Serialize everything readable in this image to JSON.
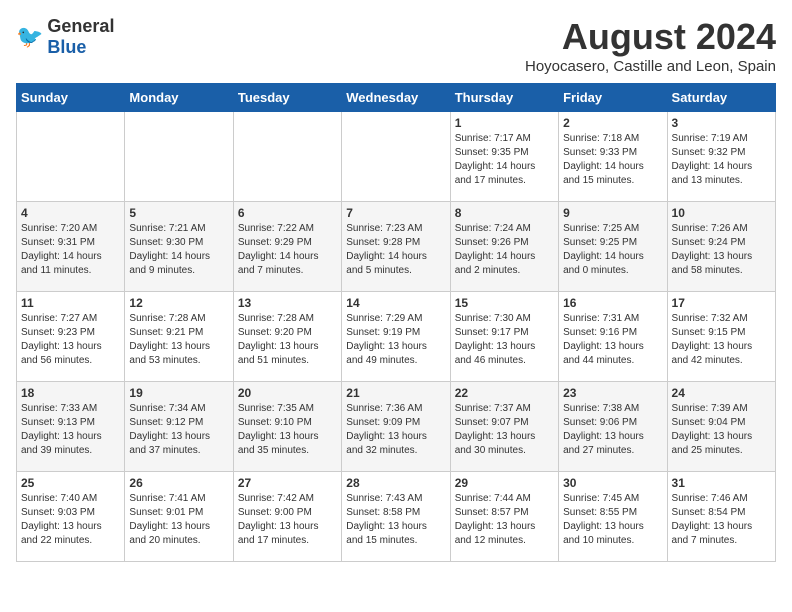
{
  "header": {
    "logo_general": "General",
    "logo_blue": "Blue",
    "title": "August 2024",
    "subtitle": "Hoyocasero, Castille and Leon, Spain"
  },
  "weekdays": [
    "Sunday",
    "Monday",
    "Tuesday",
    "Wednesday",
    "Thursday",
    "Friday",
    "Saturday"
  ],
  "weeks": [
    [
      {
        "day": "",
        "info": ""
      },
      {
        "day": "",
        "info": ""
      },
      {
        "day": "",
        "info": ""
      },
      {
        "day": "",
        "info": ""
      },
      {
        "day": "1",
        "info": "Sunrise: 7:17 AM\nSunset: 9:35 PM\nDaylight: 14 hours and 17 minutes."
      },
      {
        "day": "2",
        "info": "Sunrise: 7:18 AM\nSunset: 9:33 PM\nDaylight: 14 hours and 15 minutes."
      },
      {
        "day": "3",
        "info": "Sunrise: 7:19 AM\nSunset: 9:32 PM\nDaylight: 14 hours and 13 minutes."
      }
    ],
    [
      {
        "day": "4",
        "info": "Sunrise: 7:20 AM\nSunset: 9:31 PM\nDaylight: 14 hours and 11 minutes."
      },
      {
        "day": "5",
        "info": "Sunrise: 7:21 AM\nSunset: 9:30 PM\nDaylight: 14 hours and 9 minutes."
      },
      {
        "day": "6",
        "info": "Sunrise: 7:22 AM\nSunset: 9:29 PM\nDaylight: 14 hours and 7 minutes."
      },
      {
        "day": "7",
        "info": "Sunrise: 7:23 AM\nSunset: 9:28 PM\nDaylight: 14 hours and 5 minutes."
      },
      {
        "day": "8",
        "info": "Sunrise: 7:24 AM\nSunset: 9:26 PM\nDaylight: 14 hours and 2 minutes."
      },
      {
        "day": "9",
        "info": "Sunrise: 7:25 AM\nSunset: 9:25 PM\nDaylight: 14 hours and 0 minutes."
      },
      {
        "day": "10",
        "info": "Sunrise: 7:26 AM\nSunset: 9:24 PM\nDaylight: 13 hours and 58 minutes."
      }
    ],
    [
      {
        "day": "11",
        "info": "Sunrise: 7:27 AM\nSunset: 9:23 PM\nDaylight: 13 hours and 56 minutes."
      },
      {
        "day": "12",
        "info": "Sunrise: 7:28 AM\nSunset: 9:21 PM\nDaylight: 13 hours and 53 minutes."
      },
      {
        "day": "13",
        "info": "Sunrise: 7:28 AM\nSunset: 9:20 PM\nDaylight: 13 hours and 51 minutes."
      },
      {
        "day": "14",
        "info": "Sunrise: 7:29 AM\nSunset: 9:19 PM\nDaylight: 13 hours and 49 minutes."
      },
      {
        "day": "15",
        "info": "Sunrise: 7:30 AM\nSunset: 9:17 PM\nDaylight: 13 hours and 46 minutes."
      },
      {
        "day": "16",
        "info": "Sunrise: 7:31 AM\nSunset: 9:16 PM\nDaylight: 13 hours and 44 minutes."
      },
      {
        "day": "17",
        "info": "Sunrise: 7:32 AM\nSunset: 9:15 PM\nDaylight: 13 hours and 42 minutes."
      }
    ],
    [
      {
        "day": "18",
        "info": "Sunrise: 7:33 AM\nSunset: 9:13 PM\nDaylight: 13 hours and 39 minutes."
      },
      {
        "day": "19",
        "info": "Sunrise: 7:34 AM\nSunset: 9:12 PM\nDaylight: 13 hours and 37 minutes."
      },
      {
        "day": "20",
        "info": "Sunrise: 7:35 AM\nSunset: 9:10 PM\nDaylight: 13 hours and 35 minutes."
      },
      {
        "day": "21",
        "info": "Sunrise: 7:36 AM\nSunset: 9:09 PM\nDaylight: 13 hours and 32 minutes."
      },
      {
        "day": "22",
        "info": "Sunrise: 7:37 AM\nSunset: 9:07 PM\nDaylight: 13 hours and 30 minutes."
      },
      {
        "day": "23",
        "info": "Sunrise: 7:38 AM\nSunset: 9:06 PM\nDaylight: 13 hours and 27 minutes."
      },
      {
        "day": "24",
        "info": "Sunrise: 7:39 AM\nSunset: 9:04 PM\nDaylight: 13 hours and 25 minutes."
      }
    ],
    [
      {
        "day": "25",
        "info": "Sunrise: 7:40 AM\nSunset: 9:03 PM\nDaylight: 13 hours and 22 minutes."
      },
      {
        "day": "26",
        "info": "Sunrise: 7:41 AM\nSunset: 9:01 PM\nDaylight: 13 hours and 20 minutes."
      },
      {
        "day": "27",
        "info": "Sunrise: 7:42 AM\nSunset: 9:00 PM\nDaylight: 13 hours and 17 minutes."
      },
      {
        "day": "28",
        "info": "Sunrise: 7:43 AM\nSunset: 8:58 PM\nDaylight: 13 hours and 15 minutes."
      },
      {
        "day": "29",
        "info": "Sunrise: 7:44 AM\nSunset: 8:57 PM\nDaylight: 13 hours and 12 minutes."
      },
      {
        "day": "30",
        "info": "Sunrise: 7:45 AM\nSunset: 8:55 PM\nDaylight: 13 hours and 10 minutes."
      },
      {
        "day": "31",
        "info": "Sunrise: 7:46 AM\nSunset: 8:54 PM\nDaylight: 13 hours and 7 minutes."
      }
    ]
  ]
}
